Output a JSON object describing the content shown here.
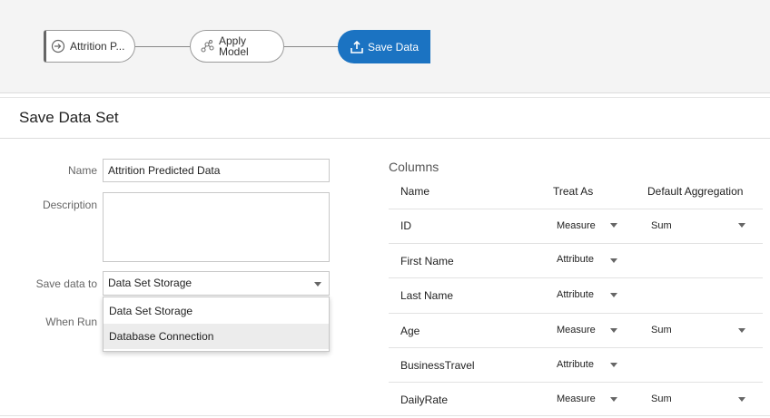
{
  "flow": {
    "source_label": "Attrition P...",
    "apply_label_1": "Apply",
    "apply_label_2": "Model",
    "save_label": "Save Data"
  },
  "page_title": "Save Data Set",
  "form": {
    "name_label": "Name",
    "name_value": "Attrition Predicted Data",
    "description_label": "Description",
    "description_value": "",
    "save_to_label": "Save data to",
    "save_to_value": "Data Set Storage",
    "save_to_options": [
      "Data Set Storage",
      "Database Connection"
    ],
    "when_run_label": "When Run"
  },
  "columns": {
    "title": "Columns",
    "headers": {
      "name": "Name",
      "treat_as": "Treat As",
      "aggregation": "Default Aggregation"
    },
    "rows": [
      {
        "name": "ID",
        "treat_as": "Measure",
        "aggregation": "Sum"
      },
      {
        "name": "First Name",
        "treat_as": "Attribute",
        "aggregation": ""
      },
      {
        "name": "Last Name",
        "treat_as": "Attribute",
        "aggregation": ""
      },
      {
        "name": "Age",
        "treat_as": "Measure",
        "aggregation": "Sum"
      },
      {
        "name": "BusinessTravel",
        "treat_as": "Attribute",
        "aggregation": ""
      },
      {
        "name": "DailyRate",
        "treat_as": "Measure",
        "aggregation": "Sum"
      }
    ]
  },
  "colors": {
    "accent": "#1b73c2",
    "highlight": "#ececec"
  },
  "icons": {
    "source": "dataset-source-icon",
    "apply": "apply-model-icon",
    "save": "save-data-icon",
    "dropdown": "chevron-down-icon"
  }
}
